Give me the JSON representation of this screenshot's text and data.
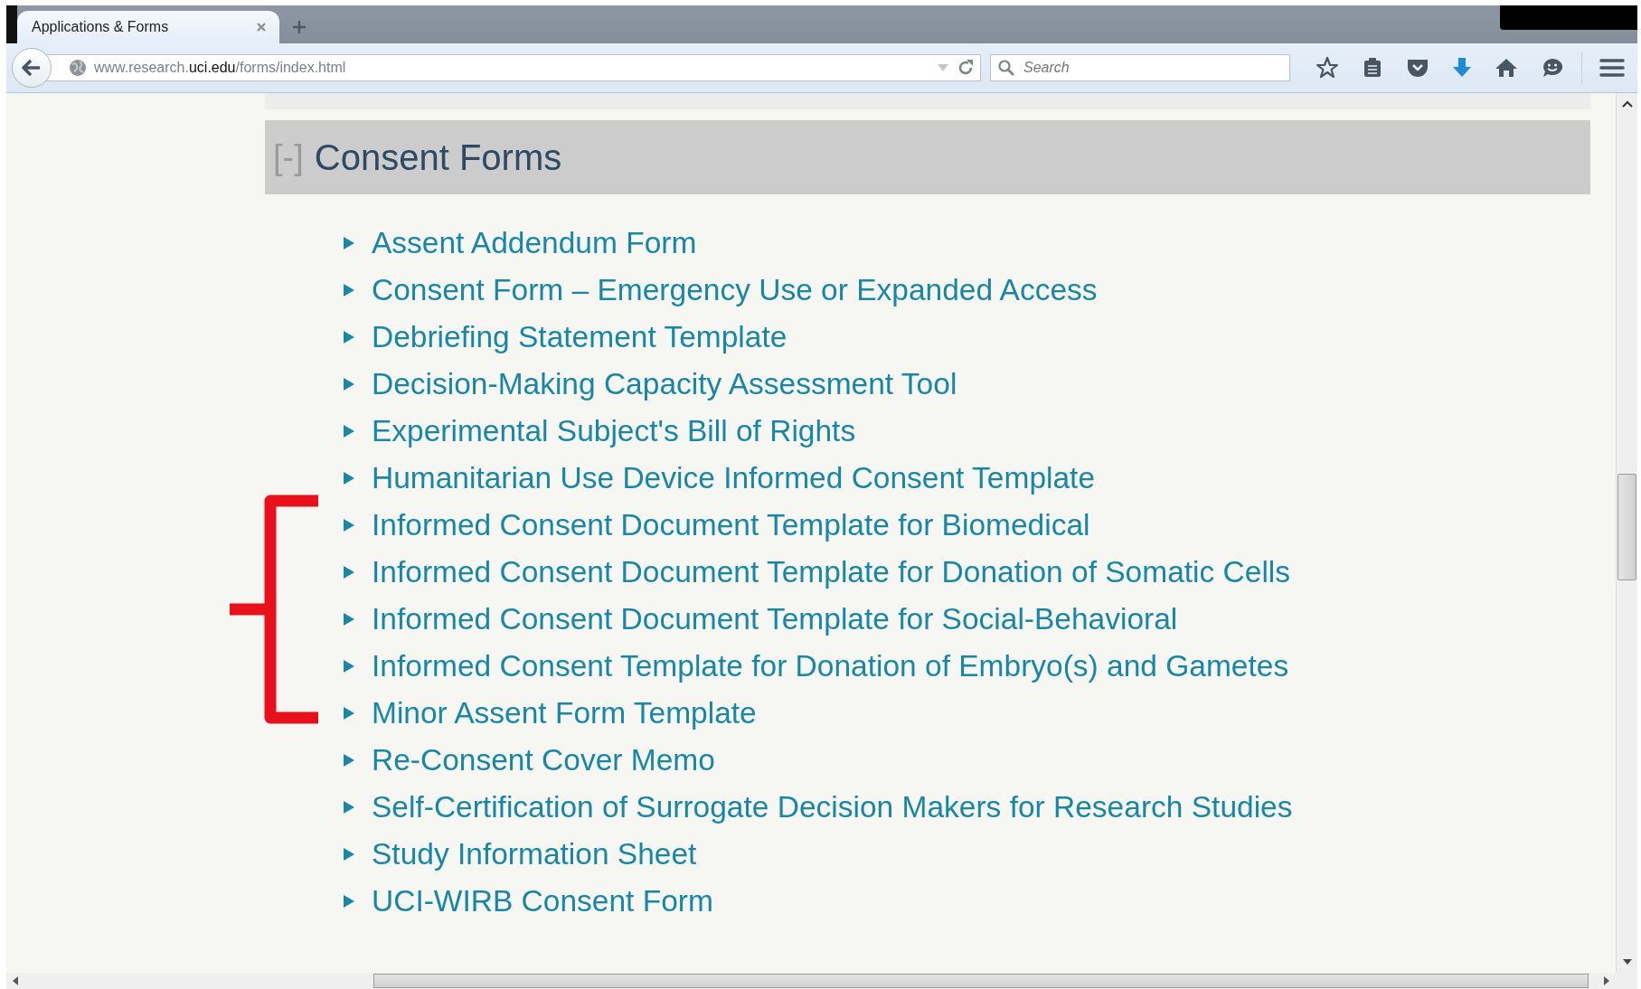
{
  "tab": {
    "title": "Applications & Forms",
    "selected": true
  },
  "address_bar": {
    "url_host_prefix": "www.research.",
    "url_domain": "uci.edu",
    "url_path": "/forms/index.html"
  },
  "search": {
    "placeholder": "Search"
  },
  "section": {
    "toggle": "[-]",
    "title": "Consent Forms"
  },
  "links": [
    {
      "label": "Assent Addendum Form"
    },
    {
      "label": "Consent Form – Emergency Use or Expanded Access"
    },
    {
      "label": "Debriefing Statement Template"
    },
    {
      "label": "Decision-Making Capacity Assessment Tool"
    },
    {
      "label": "Experimental Subject's Bill of Rights"
    },
    {
      "label": "Humanitarian Use Device Informed Consent Template"
    },
    {
      "label": "Informed Consent Document Template for Biomedical"
    },
    {
      "label": "Informed Consent Document Template for Donation of Somatic Cells"
    },
    {
      "label": "Informed Consent Document Template for Social-Behavioral"
    },
    {
      "label": "Informed Consent Template for Donation of Embryo(s) and Gametes"
    },
    {
      "label": "Minor Assent Form Template"
    },
    {
      "label": "Re-Consent Cover Memo"
    },
    {
      "label": "Self-Certification of Surrogate Decision Makers for Research Studies"
    },
    {
      "label": "Study Information Sheet"
    },
    {
      "label": "UCI-WIRB Consent Form"
    }
  ]
}
